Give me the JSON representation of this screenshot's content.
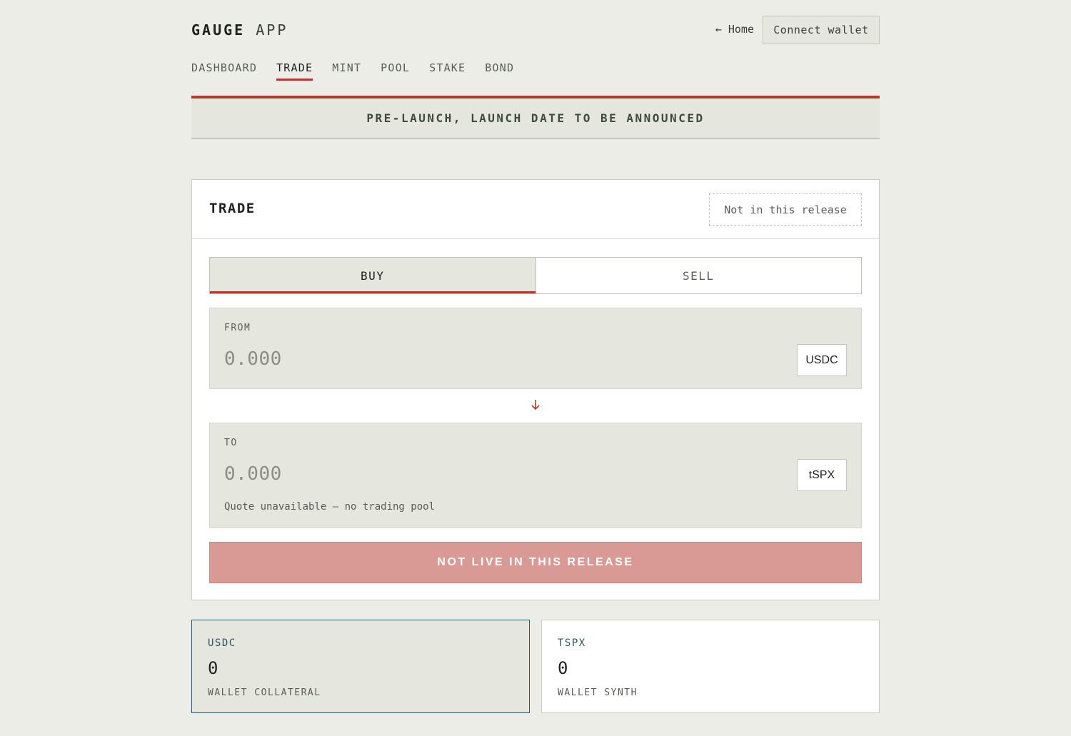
{
  "header": {
    "brand_bold": "GAUGE",
    "brand_light": "APP",
    "home_link": "← Home",
    "connect_wallet": "Connect wallet"
  },
  "nav": {
    "items": [
      {
        "label": "DASHBOARD",
        "active": false
      },
      {
        "label": "TRADE",
        "active": true
      },
      {
        "label": "MINT",
        "active": false
      },
      {
        "label": "POOL",
        "active": false
      },
      {
        "label": "STAKE",
        "active": false
      },
      {
        "label": "BOND",
        "active": false
      }
    ]
  },
  "banner": {
    "text": "PRE-LAUNCH, LAUNCH DATE TO BE ANNOUNCED"
  },
  "trade": {
    "title": "TRADE",
    "badge": "Not in this release",
    "tabs": {
      "buy": "BUY",
      "sell": "SELL",
      "active": "buy"
    },
    "from": {
      "label": "FROM",
      "placeholder": "0.000",
      "token": "USDC"
    },
    "to": {
      "label": "TO",
      "placeholder": "0.000",
      "token": "tSPX",
      "note": "Quote unavailable — no trading pool"
    },
    "action": "NOT LIVE IN THIS RELEASE"
  },
  "stats": [
    {
      "token": "USDC",
      "value": "0",
      "caption": "WALLET COLLATERAL"
    },
    {
      "token": "TSPX",
      "value": "0",
      "caption": "WALLET SYNTH"
    }
  ],
  "colors": {
    "accent": "#b03a2e",
    "background": "#ecede7",
    "panel": "#e5e7df",
    "disabled_button": "#d99994",
    "highlight_border": "#2f5566"
  }
}
